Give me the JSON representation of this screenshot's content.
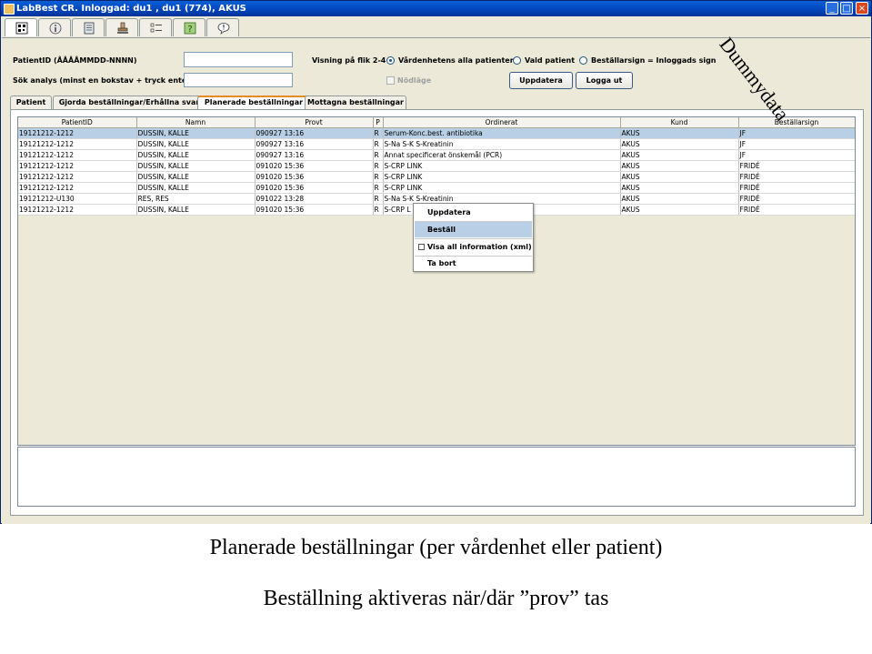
{
  "window": {
    "title": "LabBest CR. Inloggad: du1 , du1 (774), AKUS",
    "minimize": "_",
    "maximize": "□",
    "close": "×"
  },
  "toolbar_tabs": [
    {
      "icon": "barcode-icon"
    },
    {
      "icon": "info-icon"
    },
    {
      "icon": "document-icon"
    },
    {
      "icon": "stamp-icon"
    },
    {
      "icon": "checklist-icon"
    },
    {
      "icon": "help-icon"
    },
    {
      "icon": "speech-bubble-icon"
    }
  ],
  "form": {
    "patient_label": "PatientID (ÅÅÅÅMMDD-NNNN)",
    "patient_value": "",
    "search_label": "Sök analys (minst en bokstav + tryck enter)",
    "search_value": "",
    "view_label": "Visning på flik 2-4",
    "radio_all": "Vårdenhetens alla patienter",
    "radio_selected": "Vald patient",
    "radio_sign": "Beställarsign = Inloggads sign",
    "emergency_label": "Nödläge",
    "update_button": "Uppdatera",
    "logout_button": "Logga ut"
  },
  "tabs": [
    "Patient",
    "Gjorda beställningar/Erhållna svar",
    "Planerade beställningar",
    "Mottagna beställningar"
  ],
  "table": {
    "columns": [
      "PatientID",
      "Namn",
      "Provt",
      "P",
      "Ordinerat",
      "Kund",
      "Beställarsign"
    ],
    "rows": [
      [
        "19121212-1212",
        "DUSSIN, KALLE",
        "090927 13:16",
        "R",
        "Serum-Konc.best. antibiotika",
        "AKUS",
        "JF"
      ],
      [
        "19121212-1212",
        "DUSSIN, KALLE",
        "090927 13:16",
        "R",
        "S-Na S-K S-Kreatinin",
        "AKUS",
        "JF"
      ],
      [
        "19121212-1212",
        "DUSSIN, KALLE",
        "090927 13:16",
        "R",
        "Annat specificerat önskemål (PCR)",
        "AKUS",
        "JF"
      ],
      [
        "19121212-1212",
        "DUSSIN, KALLE",
        "091020 15:36",
        "R",
        "S-CRP LINK",
        "AKUS",
        "FRIDÉ"
      ],
      [
        "19121212-1212",
        "DUSSIN, KALLE",
        "091020 15:36",
        "R",
        "S-CRP LINK",
        "AKUS",
        "FRIDÉ"
      ],
      [
        "19121212-1212",
        "DUSSIN, KALLE",
        "091020 15:36",
        "R",
        "S-CRP LINK",
        "AKUS",
        "FRIDÉ"
      ],
      [
        "19121212-U130",
        "RES, RES",
        "091022 13:28",
        "R",
        "S-Na S-K S-Kreatinin",
        "AKUS",
        "FRIDÉ"
      ],
      [
        "19121212-1212",
        "DUSSIN, KALLE",
        "091020 15:36",
        "R",
        "S-CRP L",
        "AKUS",
        "FRIDÉ"
      ]
    ]
  },
  "context_menu": {
    "update": "Uppdatera",
    "order": "Beställ",
    "show_all": "Visa all information (xml)",
    "remove": "Ta bort"
  },
  "overlay_text": "Dummydata",
  "caption1": "Planerade beställningar (per vårdenhet eller patient)",
  "caption2": "Beställning aktiveras när/där ”prov” tas"
}
